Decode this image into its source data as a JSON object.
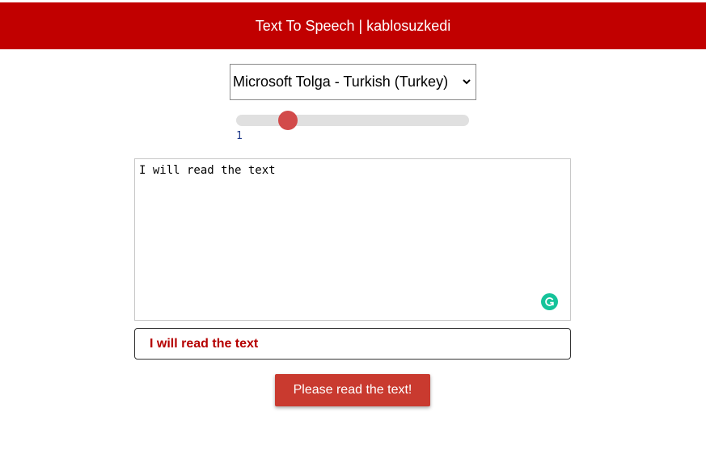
{
  "header": {
    "title": "Text To Speech | kablosuzkedi"
  },
  "voice_select": {
    "selected": "Microsoft Tolga - Turkish (Turkey)"
  },
  "rate_slider": {
    "value": 1,
    "value_label": "1"
  },
  "textarea": {
    "value": "I will read the text"
  },
  "output": {
    "text": "I will read the text"
  },
  "button": {
    "label": "Please read the text!"
  },
  "colors": {
    "header_bg": "#c10000",
    "button_bg": "#c93a2f",
    "output_text": "#b50000",
    "slider_thumb": "#d24b4b",
    "grammarly": "#15c39a"
  },
  "icons": {
    "select_arrow": "chevron-down-icon",
    "grammarly": "grammarly-icon"
  }
}
